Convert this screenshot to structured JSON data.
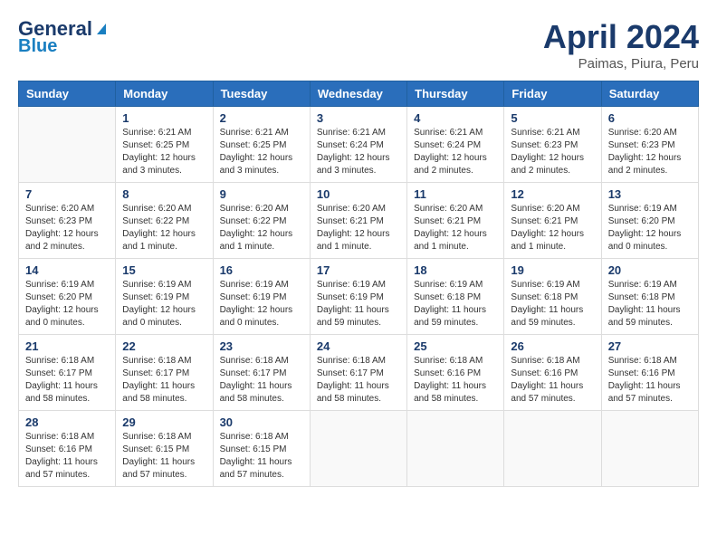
{
  "logo": {
    "line1": "General",
    "line2": "Blue"
  },
  "title": "April 2024",
  "subtitle": "Paimas, Piura, Peru",
  "days_header": [
    "Sunday",
    "Monday",
    "Tuesday",
    "Wednesday",
    "Thursday",
    "Friday",
    "Saturday"
  ],
  "weeks": [
    [
      {
        "day": "",
        "info": ""
      },
      {
        "day": "1",
        "info": "Sunrise: 6:21 AM\nSunset: 6:25 PM\nDaylight: 12 hours\nand 3 minutes."
      },
      {
        "day": "2",
        "info": "Sunrise: 6:21 AM\nSunset: 6:25 PM\nDaylight: 12 hours\nand 3 minutes."
      },
      {
        "day": "3",
        "info": "Sunrise: 6:21 AM\nSunset: 6:24 PM\nDaylight: 12 hours\nand 3 minutes."
      },
      {
        "day": "4",
        "info": "Sunrise: 6:21 AM\nSunset: 6:24 PM\nDaylight: 12 hours\nand 2 minutes."
      },
      {
        "day": "5",
        "info": "Sunrise: 6:21 AM\nSunset: 6:23 PM\nDaylight: 12 hours\nand 2 minutes."
      },
      {
        "day": "6",
        "info": "Sunrise: 6:20 AM\nSunset: 6:23 PM\nDaylight: 12 hours\nand 2 minutes."
      }
    ],
    [
      {
        "day": "7",
        "info": "Sunrise: 6:20 AM\nSunset: 6:23 PM\nDaylight: 12 hours\nand 2 minutes."
      },
      {
        "day": "8",
        "info": "Sunrise: 6:20 AM\nSunset: 6:22 PM\nDaylight: 12 hours\nand 1 minute."
      },
      {
        "day": "9",
        "info": "Sunrise: 6:20 AM\nSunset: 6:22 PM\nDaylight: 12 hours\nand 1 minute."
      },
      {
        "day": "10",
        "info": "Sunrise: 6:20 AM\nSunset: 6:21 PM\nDaylight: 12 hours\nand 1 minute."
      },
      {
        "day": "11",
        "info": "Sunrise: 6:20 AM\nSunset: 6:21 PM\nDaylight: 12 hours\nand 1 minute."
      },
      {
        "day": "12",
        "info": "Sunrise: 6:20 AM\nSunset: 6:21 PM\nDaylight: 12 hours\nand 1 minute."
      },
      {
        "day": "13",
        "info": "Sunrise: 6:19 AM\nSunset: 6:20 PM\nDaylight: 12 hours\nand 0 minutes."
      }
    ],
    [
      {
        "day": "14",
        "info": "Sunrise: 6:19 AM\nSunset: 6:20 PM\nDaylight: 12 hours\nand 0 minutes."
      },
      {
        "day": "15",
        "info": "Sunrise: 6:19 AM\nSunset: 6:19 PM\nDaylight: 12 hours\nand 0 minutes."
      },
      {
        "day": "16",
        "info": "Sunrise: 6:19 AM\nSunset: 6:19 PM\nDaylight: 12 hours\nand 0 minutes."
      },
      {
        "day": "17",
        "info": "Sunrise: 6:19 AM\nSunset: 6:19 PM\nDaylight: 11 hours\nand 59 minutes."
      },
      {
        "day": "18",
        "info": "Sunrise: 6:19 AM\nSunset: 6:18 PM\nDaylight: 11 hours\nand 59 minutes."
      },
      {
        "day": "19",
        "info": "Sunrise: 6:19 AM\nSunset: 6:18 PM\nDaylight: 11 hours\nand 59 minutes."
      },
      {
        "day": "20",
        "info": "Sunrise: 6:19 AM\nSunset: 6:18 PM\nDaylight: 11 hours\nand 59 minutes."
      }
    ],
    [
      {
        "day": "21",
        "info": "Sunrise: 6:18 AM\nSunset: 6:17 PM\nDaylight: 11 hours\nand 58 minutes."
      },
      {
        "day": "22",
        "info": "Sunrise: 6:18 AM\nSunset: 6:17 PM\nDaylight: 11 hours\nand 58 minutes."
      },
      {
        "day": "23",
        "info": "Sunrise: 6:18 AM\nSunset: 6:17 PM\nDaylight: 11 hours\nand 58 minutes."
      },
      {
        "day": "24",
        "info": "Sunrise: 6:18 AM\nSunset: 6:17 PM\nDaylight: 11 hours\nand 58 minutes."
      },
      {
        "day": "25",
        "info": "Sunrise: 6:18 AM\nSunset: 6:16 PM\nDaylight: 11 hours\nand 58 minutes."
      },
      {
        "day": "26",
        "info": "Sunrise: 6:18 AM\nSunset: 6:16 PM\nDaylight: 11 hours\nand 57 minutes."
      },
      {
        "day": "27",
        "info": "Sunrise: 6:18 AM\nSunset: 6:16 PM\nDaylight: 11 hours\nand 57 minutes."
      }
    ],
    [
      {
        "day": "28",
        "info": "Sunrise: 6:18 AM\nSunset: 6:16 PM\nDaylight: 11 hours\nand 57 minutes."
      },
      {
        "day": "29",
        "info": "Sunrise: 6:18 AM\nSunset: 6:15 PM\nDaylight: 11 hours\nand 57 minutes."
      },
      {
        "day": "30",
        "info": "Sunrise: 6:18 AM\nSunset: 6:15 PM\nDaylight: 11 hours\nand 57 minutes."
      },
      {
        "day": "",
        "info": ""
      },
      {
        "day": "",
        "info": ""
      },
      {
        "day": "",
        "info": ""
      },
      {
        "day": "",
        "info": ""
      }
    ]
  ]
}
